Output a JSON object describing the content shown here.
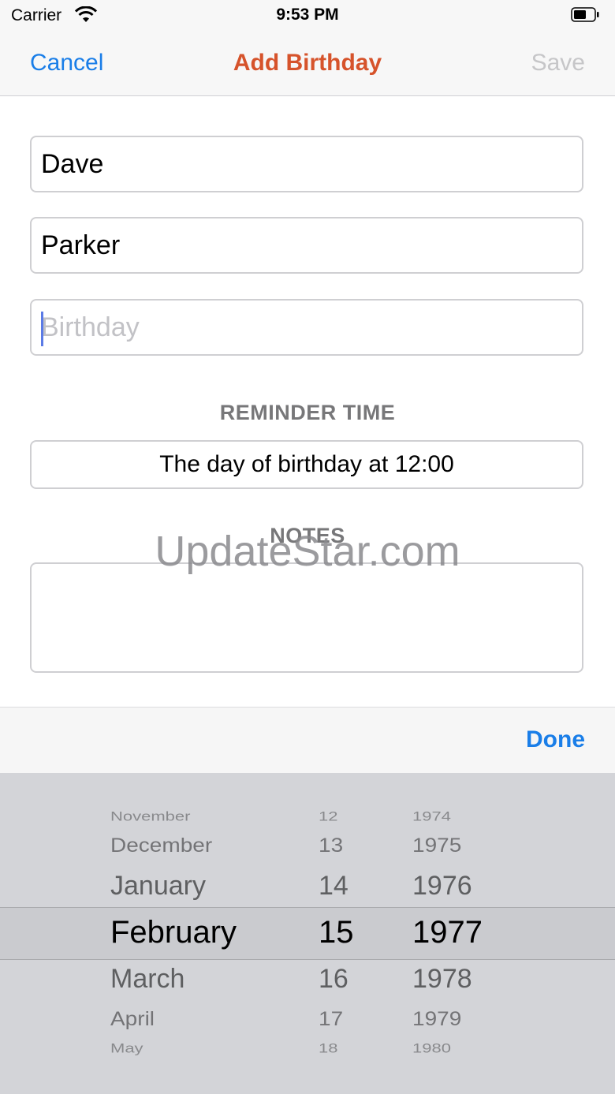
{
  "status_bar": {
    "carrier": "Carrier",
    "time": "9:53 PM"
  },
  "nav": {
    "cancel_label": "Cancel",
    "title": "Add Birthday",
    "save_label": "Save"
  },
  "form": {
    "first_name_value": "Dave",
    "last_name_value": "Parker",
    "birthday_placeholder": "Birthday",
    "reminder_label": "REMINDER TIME",
    "reminder_value": "The day of birthday at 12:00",
    "notes_label": "NOTES",
    "notes_value": ""
  },
  "watermark": "UpdateStar.com",
  "toolbar": {
    "done_label": "Done"
  },
  "picker": {
    "months": [
      "November",
      "December",
      "January",
      "February",
      "March",
      "April",
      "May"
    ],
    "days": [
      "12",
      "13",
      "14",
      "15",
      "16",
      "17",
      "18"
    ],
    "years": [
      "1974",
      "1975",
      "1976",
      "1977",
      "1978",
      "1979",
      "1980"
    ],
    "selected": {
      "month": "February",
      "day": "15",
      "year": "1977"
    }
  },
  "colors": {
    "accent": "#1a7ee8",
    "title": "#d6532b",
    "disabled": "#c6c6c8"
  }
}
